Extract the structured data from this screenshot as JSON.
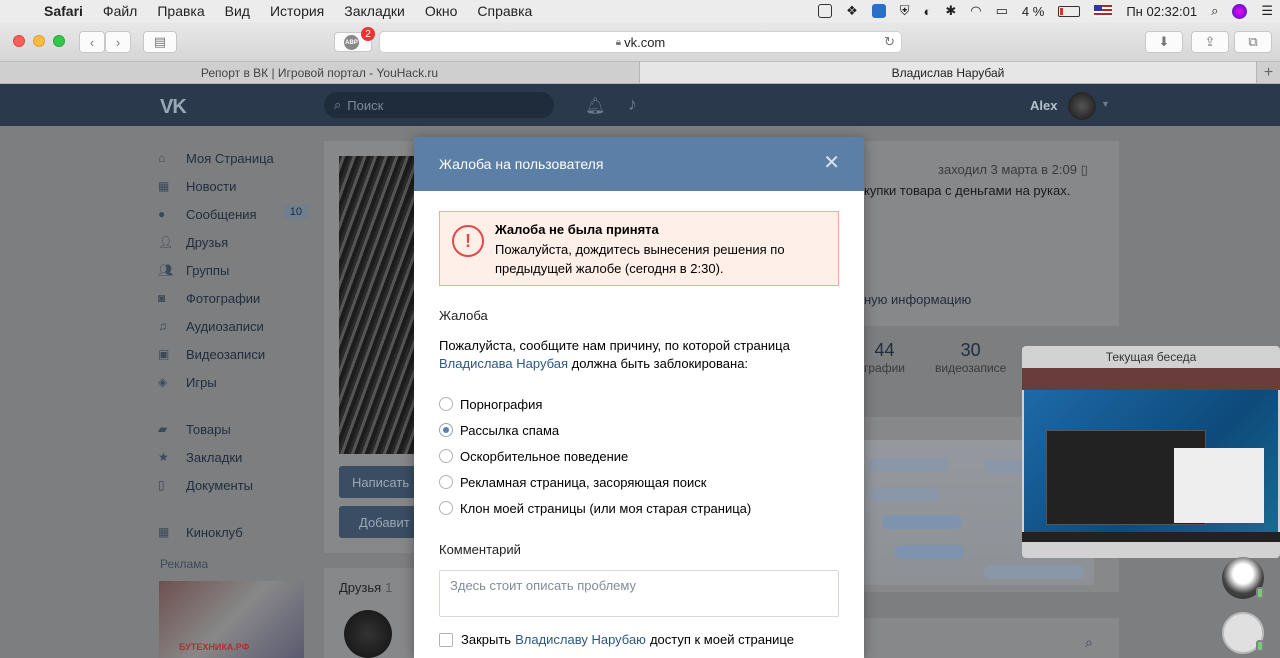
{
  "menubar": {
    "app": "Safari",
    "items": [
      "Файл",
      "Правка",
      "Вид",
      "История",
      "Закладки",
      "Окно",
      "Справка"
    ],
    "battery": "4 %",
    "clock": "Пн 02:32:01"
  },
  "toolbar": {
    "url": "vk.com",
    "abp_label": "ABP",
    "abp_badge": "2"
  },
  "tabs": [
    {
      "title": "Репорт в ВК | Игровой портал - YouHack.ru",
      "active": false
    },
    {
      "title": "Владислав Нарубай",
      "active": true
    }
  ],
  "vk_header": {
    "logo": "VK",
    "search_placeholder": "Поиск",
    "user_name": "Alex"
  },
  "leftnav": {
    "items": [
      {
        "label": "Моя Страница",
        "icon": "home-icon"
      },
      {
        "label": "Новости",
        "icon": "news-icon"
      },
      {
        "label": "Сообщения",
        "icon": "chat-icon",
        "count": "10"
      },
      {
        "label": "Друзья",
        "icon": "friends-icon"
      },
      {
        "label": "Группы",
        "icon": "groups-icon"
      },
      {
        "label": "Фотографии",
        "icon": "camera-icon"
      },
      {
        "label": "Аудиозаписи",
        "icon": "music-icon"
      },
      {
        "label": "Видеозаписи",
        "icon": "video-icon"
      },
      {
        "label": "Игры",
        "icon": "gamepad-icon"
      },
      {
        "label": "Товары",
        "icon": "shop-icon"
      },
      {
        "label": "Закладки",
        "icon": "star-icon"
      },
      {
        "label": "Документы",
        "icon": "document-icon"
      },
      {
        "label": "Киноклуб",
        "icon": "grid-icon"
      }
    ],
    "ads_title": "Реклама",
    "ad_text": "БУТЕХНИКА.РФ"
  },
  "profile": {
    "write_button": "Написать",
    "add_button": "Добавит",
    "friends_label": "Друзья",
    "friends_count": "1",
    "last_seen": "заходил 3 марта в 2:09",
    "status_text": "купки товара с деньгами на руках.",
    "info_link": "ную информацию",
    "counters": [
      {
        "num": "44",
        "label": "графии"
      },
      {
        "num": "30",
        "label": "видеозаписе"
      }
    ]
  },
  "pip": {
    "title": "Текущая беседа"
  },
  "modal": {
    "title": "Жалоба на пользователя",
    "alert": {
      "title": "Жалоба не была принята",
      "text": "Пожалуйста, дождитесь вынесения решения по предыдущей жалобе (сегодня в 2:30)."
    },
    "complaint_label": "Жалоба",
    "reason_prefix": "Пожалуйста, сообщите нам причину, по которой страница ",
    "reason_link": "Владислава Нарубая",
    "reason_suffix": " должна быть заблокирована:",
    "options": [
      {
        "label": "Порнография",
        "selected": false
      },
      {
        "label": "Рассылка спама",
        "selected": true
      },
      {
        "label": "Оскорбительное поведение",
        "selected": false
      },
      {
        "label": "Рекламная страница, засоряющая поиск",
        "selected": false
      },
      {
        "label": "Клон моей страницы (или моя старая страница)",
        "selected": false
      }
    ],
    "comment_label": "Комментарий",
    "comment_placeholder": "Здесь стоит описать проблему",
    "close_access_prefix": "Закрыть ",
    "close_access_link": "Владиславу Нарубаю",
    "close_access_suffix": " доступ к моей странице"
  }
}
